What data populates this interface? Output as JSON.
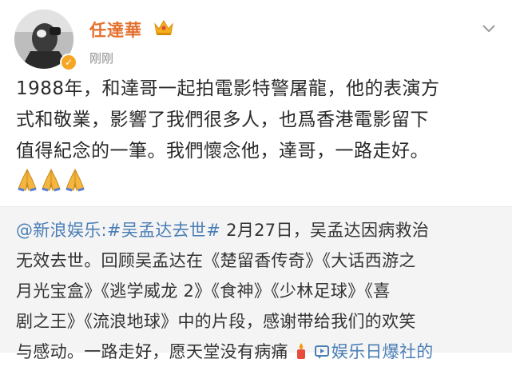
{
  "post": {
    "author": "任達華",
    "timestamp": "刚刚",
    "text_lines": [
      "1988年，和達哥一起拍電影特警屠龍，他的表演方",
      "式和敬業，影響了我們很多人，也爲香港電影留下",
      "值得紀念的一筆。我們懷念他，達哥，一路走好。"
    ],
    "emoji": [
      "pray-icon",
      "pray-icon",
      "pray-icon"
    ]
  },
  "repost": {
    "mention": "@新浪娱乐",
    "colon": ":",
    "hashtag": "#吴孟达去世#",
    "line1_rest": " 2月27日，吴孟达因病救治",
    "line2": "无效去世。回顾吴孟达在《楚留香传奇》《大话西游之",
    "line3": "月光宝盒》《逃学威龙 2》《食神》《少林足球》《喜",
    "line4": "剧之王》《流浪地球》中的片段，感谢带给我们的欢笑",
    "line5": "与感动。一路走好，愿天堂没有病痛",
    "link_text": "娱乐日爆社的",
    "link_icon": "video-link-icon",
    "candle_icon": "candle-icon"
  },
  "colors": {
    "author": "#e36f2c",
    "link": "#4a7eb5",
    "repost_bg": "#f4f4f4",
    "verified": "#f5a623"
  }
}
